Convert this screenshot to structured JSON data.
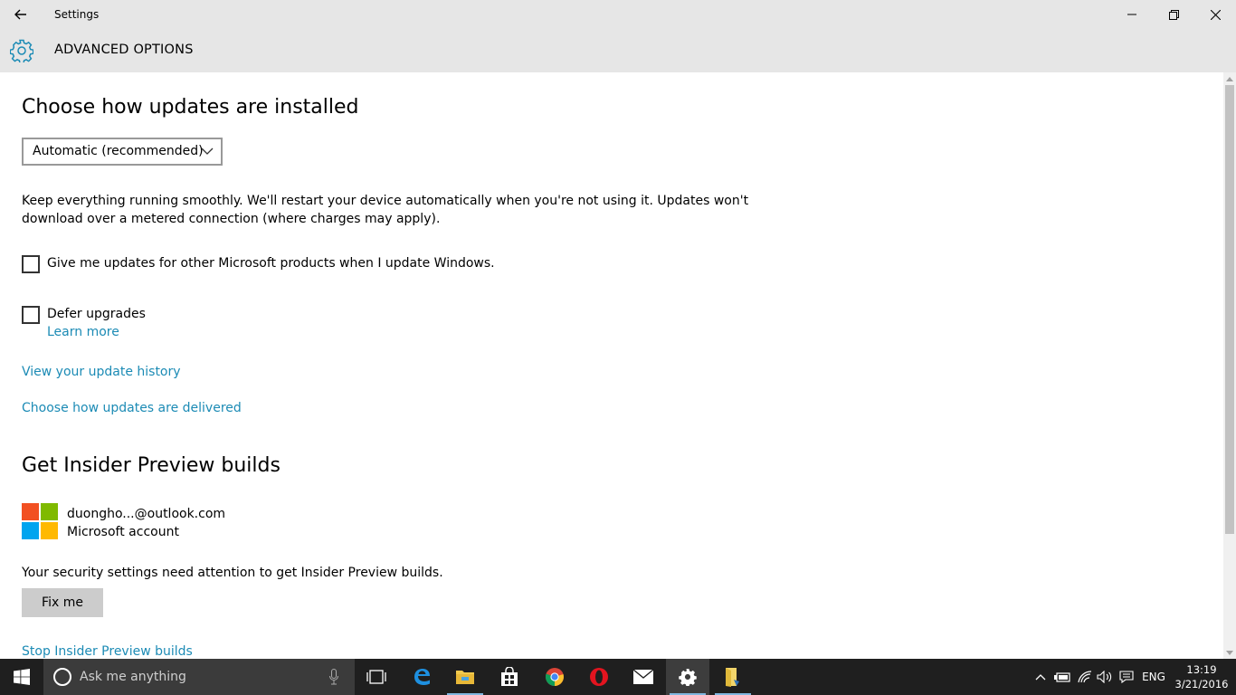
{
  "window": {
    "title": "Settings",
    "controls": {
      "minimize": "minimize-icon",
      "maximize": "restore-icon",
      "close": "close-icon"
    }
  },
  "header": {
    "title": "ADVANCED OPTIONS",
    "icon": "gear-icon"
  },
  "main": {
    "section_install": {
      "heading": "Choose how updates are installed",
      "dropdown_value": "Automatic (recommended)",
      "description_line1": "Keep everything running smoothly. We'll restart your device automatically when you're not using it. Updates won't",
      "description_line2": "download over a metered connection (where charges may apply)."
    },
    "checkboxes": [
      {
        "label": "Give me updates for other Microsoft products when I update Windows.",
        "checked": false
      },
      {
        "label": "Defer upgrades",
        "checked": false
      }
    ],
    "learn_more": "Learn more",
    "links": {
      "history": "View your update history",
      "delivered": "Choose how updates are delivered"
    },
    "section_insider": {
      "heading": "Get Insider Preview builds",
      "account_email": "duongho...@outlook.com",
      "account_type": "Microsoft account",
      "security_message": "Your security settings need attention to get Insider Preview builds.",
      "fix_button": "Fix me",
      "stop_link": "Stop Insider Preview builds"
    }
  },
  "taskbar": {
    "search_placeholder": "Ask me anything",
    "pinned": [
      "task-view-icon",
      "edge-icon",
      "file-explorer-icon",
      "store-icon",
      "chrome-icon",
      "opera-icon",
      "mail-icon",
      "settings-icon",
      "folder-app-icon"
    ],
    "language": "ENG",
    "time": "13:19",
    "date": "3/21/2016"
  },
  "colors": {
    "accent": "#1c8bb5",
    "header_bg": "#e6e6e6",
    "taskbar_bg": "#1f1f1f"
  }
}
